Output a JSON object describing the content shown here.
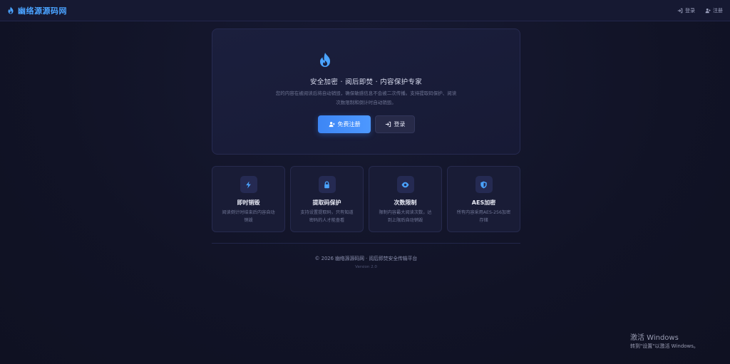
{
  "header": {
    "brand": "幽络源源码网",
    "login_label": "登录",
    "register_label": "注册"
  },
  "hero": {
    "title": "安全加密 · 阅后即焚 · 内容保护专家",
    "description": "您的内容在被阅读后将自动销毁，确保敏感信息不会被二次传播。支持提取码保护、阅读次数限制和倒计时自动销毁。",
    "primary_button": "免费注册",
    "secondary_button": "登录"
  },
  "features": [
    {
      "icon": "lightning-icon",
      "title": "即时销毁",
      "description": "阅读倒计时结束后内容自动销毁"
    },
    {
      "icon": "lock-icon",
      "title": "提取码保护",
      "description": "支持设置提取码，只有知道密码的人才能查看"
    },
    {
      "icon": "eye-icon",
      "title": "次数限制",
      "description": "限制内容最大阅读次数，达到上限后自动销毁"
    },
    {
      "icon": "shield-icon",
      "title": "AES加密",
      "description": "所有内容采用AES-256加密存储"
    }
  ],
  "footer": {
    "copyright": "© 2026 幽络源源码网 · 阅后即焚安全传输平台",
    "version": "Version 2.0"
  },
  "windows_watermark": {
    "title": "激活 Windows",
    "subtitle": "转到\"设置\"以激活 Windows。"
  },
  "colors": {
    "accent": "#4aa3ff",
    "primary_button": "#3d86f5",
    "background": "#111326",
    "card": "#191c36"
  }
}
